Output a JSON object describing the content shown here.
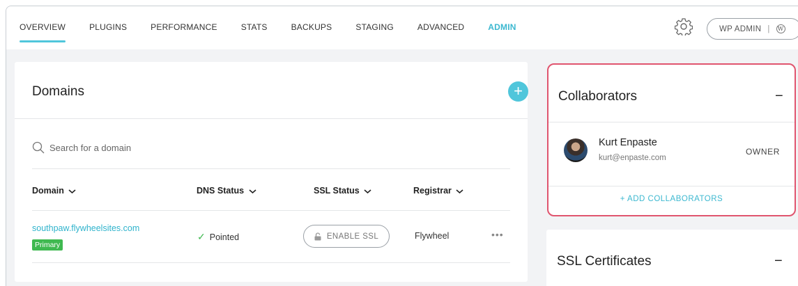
{
  "nav": {
    "tabs": [
      "OVERVIEW",
      "PLUGINS",
      "PERFORMANCE",
      "STATS",
      "BACKUPS",
      "STAGING",
      "ADVANCED",
      "ADMIN"
    ],
    "wp_admin_label": "WP ADMIN",
    "wp_admin_separator": "|",
    "wp_logo_glyph": "W"
  },
  "domains": {
    "title": "Domains",
    "add_glyph": "+",
    "search_placeholder": "Search for a domain",
    "columns": [
      "Domain",
      "DNS Status",
      "SSL Status",
      "Registrar"
    ],
    "rows": [
      {
        "domain": "southpaw.flywheelsites.com",
        "badge": "Primary",
        "dns_status": "Pointed",
        "ssl_button": "ENABLE SSL",
        "registrar": "Flywheel",
        "more": "•••"
      }
    ]
  },
  "collaborators": {
    "title": "Collaborators",
    "collapse_glyph": "−",
    "users": [
      {
        "name": "Kurt Enpaste",
        "email": "kurt@enpaste.com",
        "role": "OWNER"
      }
    ],
    "add_label": "+ ADD COLLABORATORS"
  },
  "ssl_certificates": {
    "title": "SSL Certificates",
    "collapse_glyph": "−"
  },
  "colors": {
    "accent": "#50c6db",
    "highlight_border": "#e0546e",
    "primary_badge": "#3fb950"
  }
}
